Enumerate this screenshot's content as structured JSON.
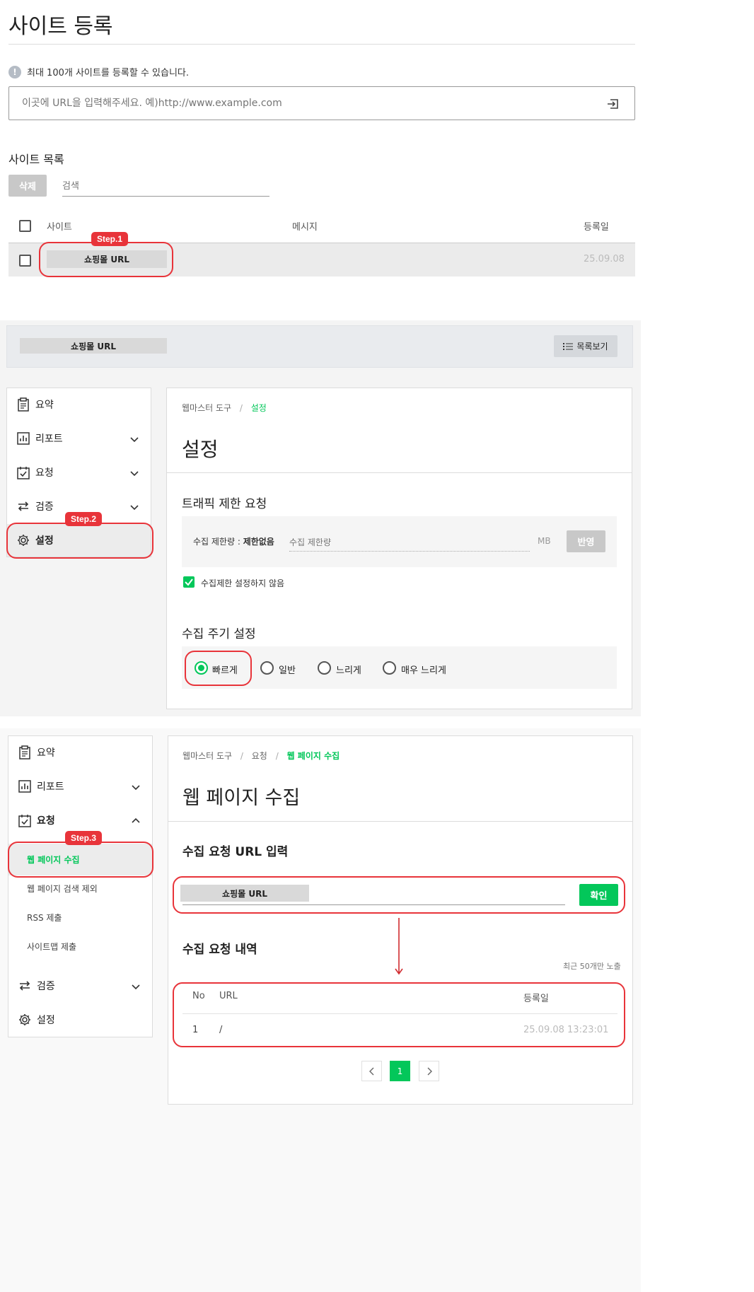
{
  "register": {
    "title": "사이트 등록",
    "notice": "최대 100개 사이트를 등록할 수 있습니다.",
    "url_placeholder": "이곳에 URL을 입력해주세요. 예)http://www.example.com",
    "list_title": "사이트 목록",
    "delete_label": "삭제",
    "search_placeholder": "검색",
    "columns": {
      "site": "사이트",
      "message": "메시지",
      "date": "등록일"
    },
    "row": {
      "site": "쇼핑몰 URL",
      "date": "25.09.08"
    },
    "step": "Step.1"
  },
  "settings_panel": {
    "site_chip": "쇼핑몰 URL",
    "list_view": "목록보기",
    "sidebar": {
      "summary": "요약",
      "report": "리포트",
      "request": "요청",
      "verify": "검증",
      "settings": "설정",
      "step": "Step.2"
    },
    "breadcrumb": {
      "root": "웹마스터 도구",
      "sep": "/",
      "current": "설정"
    },
    "title": "설정",
    "traffic": {
      "title": "트래픽 제한 요청",
      "limit_label": "수집 제한량 : ",
      "limit_value": "제한없음",
      "limit_placeholder": "수집 제한량",
      "unit": "MB",
      "apply": "반영",
      "no_limit": "수집제한 설정하지 않음"
    },
    "cycle": {
      "title": "수집 주기 설정",
      "fast": "빠르게",
      "normal": "일반",
      "slow": "느리게",
      "very_slow": "매우 느리게"
    }
  },
  "collect_panel": {
    "sidebar": {
      "summary": "요약",
      "report": "리포트",
      "request": "요청",
      "web_page_collect": "웹 페이지 수집",
      "exclude_search": "웹 페이지 검색 제외",
      "rss": "RSS 제출",
      "sitemap": "사이트맵 제출",
      "verify": "검증",
      "settings": "설정",
      "step": "Step.3"
    },
    "breadcrumb": {
      "root": "웹마스터 도구",
      "sep": "/",
      "mid": "요청",
      "current": "웹 페이지 수집"
    },
    "title": "웹 페이지 수집",
    "input_title": "수집 요청 URL 입력",
    "url_chip": "쇼핑몰 URL",
    "confirm": "확인",
    "history_title": "수집 요청 내역",
    "recent_note": "최근 50개만 노출",
    "columns": {
      "no": "No",
      "url": "URL",
      "date": "등록일"
    },
    "row": {
      "no": "1",
      "url": "/",
      "date": "25.09.08 13:23:01"
    },
    "page": "1"
  },
  "colors": {
    "accent_green": "#03c75a",
    "step_red": "#e8343a"
  }
}
